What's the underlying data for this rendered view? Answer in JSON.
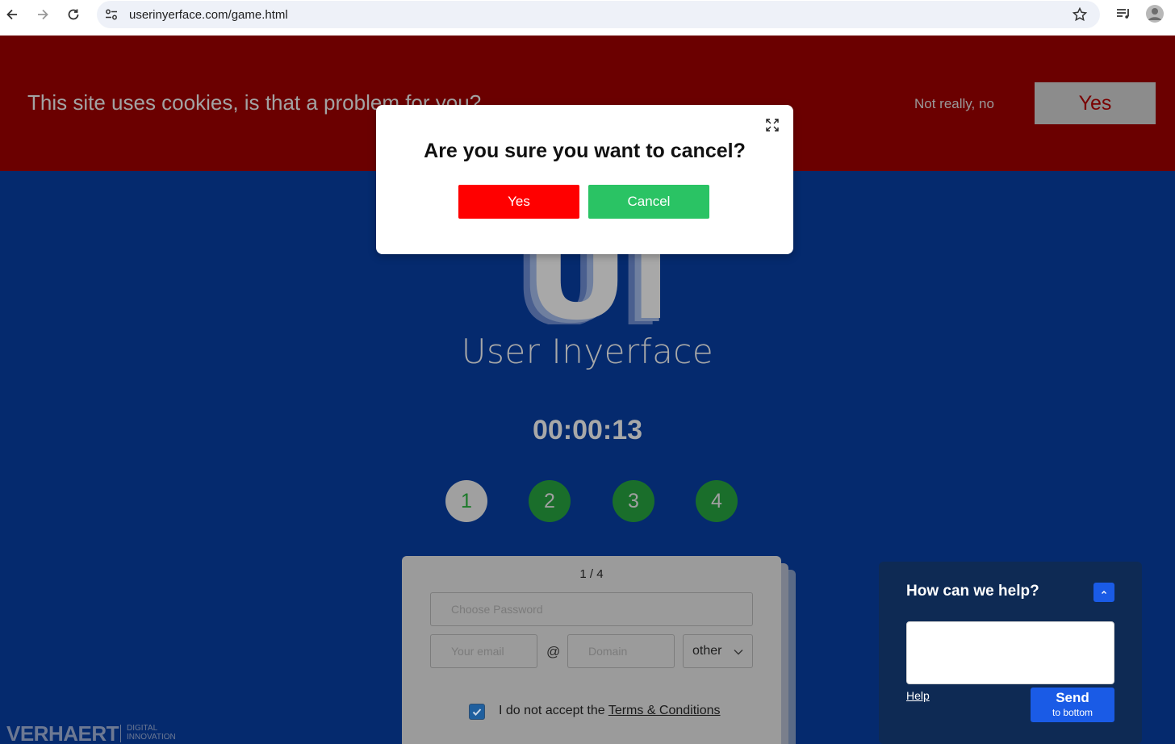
{
  "browser": {
    "url": "userinyerface.com/game.html"
  },
  "cookie_banner": {
    "text": "This site uses cookies, is that a problem for you?",
    "decline_label": "Not really, no",
    "accept_label": "Yes"
  },
  "hero": {
    "logo_letters": "UI",
    "brand": "User Inyerface",
    "timer": "00:00:13"
  },
  "steps": [
    "1",
    "2",
    "3",
    "4"
  ],
  "form_card": {
    "pager": "1 / 4",
    "password_placeholder": "Choose Password",
    "email_placeholder": "Your email",
    "at_sign": "@",
    "domain_placeholder": "Domain",
    "tld_value": "other",
    "terms_prefix": "I do not accept the ",
    "terms_link": "Terms & Conditions"
  },
  "help_widget": {
    "title": "How can we help?",
    "help_link": "Help",
    "send_label": "Send",
    "send_sublabel": "to bottom"
  },
  "footer_logo": {
    "name": "VERHAERT",
    "sub_line1": "DIGITAL",
    "sub_line2": "INNOVATION"
  },
  "modal": {
    "title": "Are you sure you want to cancel?",
    "yes_label": "Yes",
    "cancel_label": "Cancel"
  },
  "colors": {
    "cookie_bg": "#6b0000",
    "page_bg": "#052a6e",
    "modal_yes": "#ff0000",
    "modal_cancel": "#2ac364",
    "help_send": "#1a5be6"
  }
}
